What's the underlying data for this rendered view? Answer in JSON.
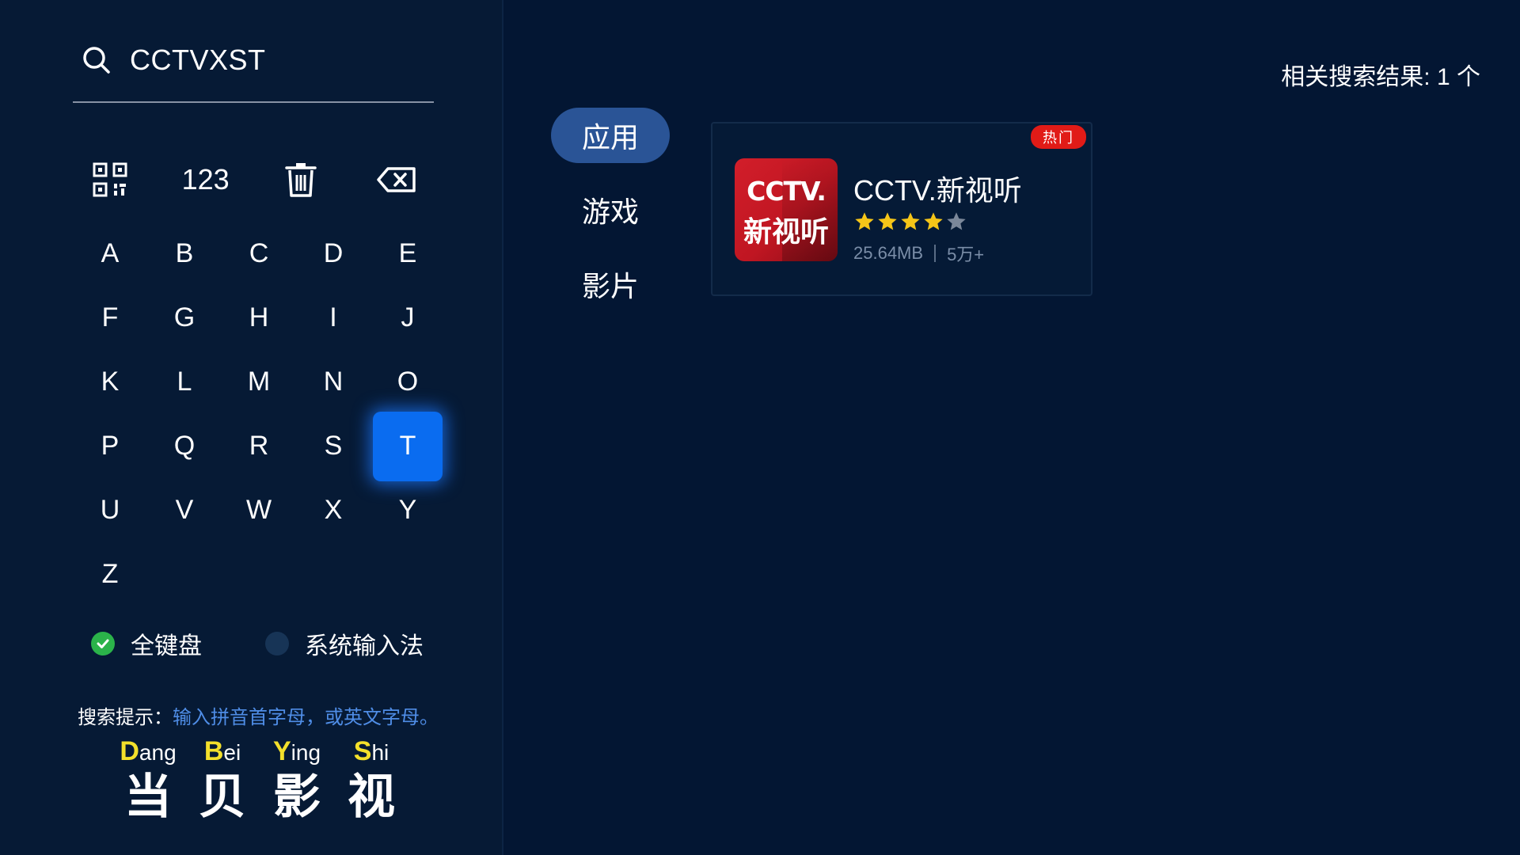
{
  "search": {
    "icon": "search-icon",
    "query": "CCTVXST"
  },
  "keyboard": {
    "function_keys": [
      {
        "name": "qrcode-icon",
        "label": ""
      },
      {
        "name": "numeric-key",
        "label": "123"
      },
      {
        "name": "trash-icon",
        "label": ""
      },
      {
        "name": "backspace-icon",
        "label": ""
      }
    ],
    "letters": [
      "A",
      "B",
      "C",
      "D",
      "E",
      "F",
      "G",
      "H",
      "I",
      "J",
      "K",
      "L",
      "M",
      "N",
      "O",
      "P",
      "Q",
      "R",
      "S",
      "T",
      "U",
      "V",
      "W",
      "X",
      "Y",
      "Z"
    ],
    "active_key": "T",
    "active_color": "#0a6cf0",
    "options": [
      {
        "label": "全键盘",
        "checked": true
      },
      {
        "label": "系统输入法",
        "checked": false
      }
    ]
  },
  "hint": {
    "prefix": "搜索提示：",
    "text": "输入拼音首字母，或英文字母。"
  },
  "brand": [
    {
      "initial": "D",
      "rest": "ang",
      "char": "当"
    },
    {
      "initial": "B",
      "rest": "ei",
      "char": "贝"
    },
    {
      "initial": "Y",
      "rest": "ing",
      "char": "影"
    },
    {
      "initial": "S",
      "rest": "hi",
      "char": "视"
    }
  ],
  "results": {
    "count_label": "相关搜索结果: 1 个"
  },
  "categories": [
    {
      "label": "应用",
      "active": true
    },
    {
      "label": "游戏",
      "active": false
    },
    {
      "label": "影片",
      "active": false
    }
  ],
  "app": {
    "badge": "热门",
    "icon_line1": "CCTV.",
    "icon_line2": "新视听",
    "name": "CCTV.新视听",
    "rating": 4,
    "rating_max": 5,
    "size": "25.64MB",
    "downloads": "5万+",
    "colors": {
      "star": "#f5c518",
      "star_empty": "#7b8799",
      "badge": "#e11b17"
    }
  }
}
